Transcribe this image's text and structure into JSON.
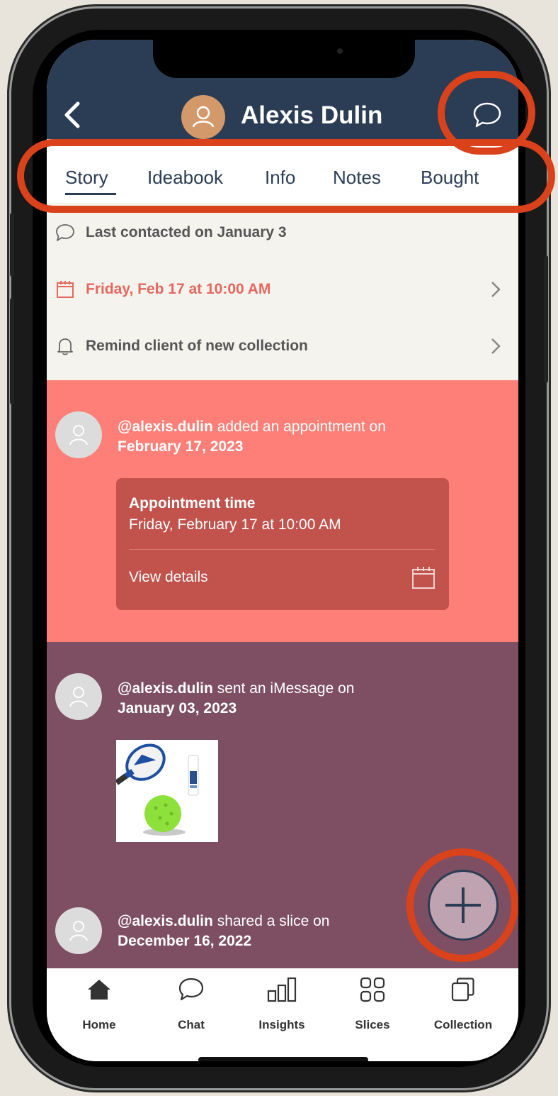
{
  "header": {
    "back_icon": "back-chevron-icon",
    "title": "Alexis Dulin",
    "avatar_icon": "person-icon",
    "chat_icon": "chat-bubble-icon",
    "bg_color": "#2b3d55"
  },
  "tabs": [
    {
      "label": "Story",
      "active": true
    },
    {
      "label": "Ideabook"
    },
    {
      "label": "Info"
    },
    {
      "label": "Notes"
    },
    {
      "label": "Bought"
    }
  ],
  "info_rows": {
    "last_contacted": "Last contacted on January 3",
    "appointment": "Friday, Feb 17 at 10:00 AM",
    "reminder": "Remind client of new collection"
  },
  "feed": [
    {
      "handle": "@alexis.dulin",
      "action": " added an appointment on",
      "date": "February 17, 2023",
      "card": {
        "title": "Appointment time",
        "subtitle": "Friday, February 17 at 10:00 AM",
        "link": "View details"
      },
      "bg_color": "#fe7f77"
    },
    {
      "handle": "@alexis.dulin",
      "action": " sent an iMessage on",
      "date": "January 03, 2023",
      "bg_color": "#7e4f62"
    },
    {
      "handle": "@alexis.dulin",
      "action": " shared a slice on",
      "date": "December 16, 2022"
    }
  ],
  "bottom_nav": [
    {
      "label": "Home",
      "icon": "home-icon"
    },
    {
      "label": "Chat",
      "icon": "chat-icon"
    },
    {
      "label": "Insights",
      "icon": "insights-icon"
    },
    {
      "label": "Slices",
      "icon": "slices-icon"
    },
    {
      "label": "Collection",
      "icon": "collection-icon"
    }
  ],
  "fab_icon": "plus-icon",
  "annotation_color": "#d9421b"
}
